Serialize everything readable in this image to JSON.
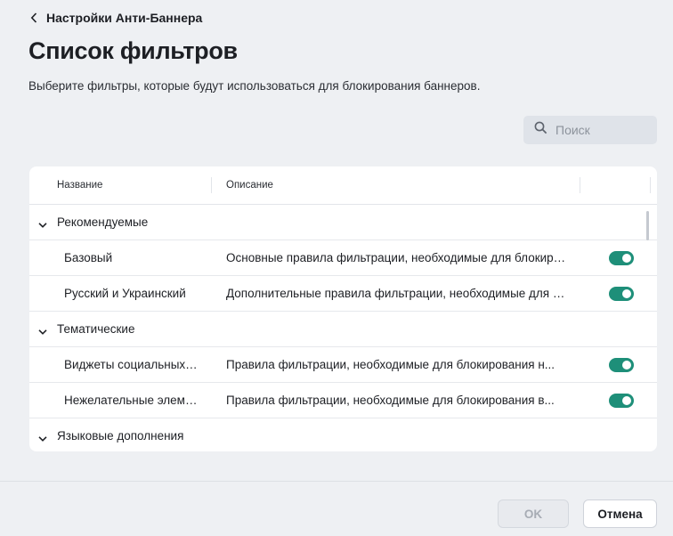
{
  "header": {
    "back_label": "Настройки Анти-Баннера",
    "title": "Список фильтров",
    "description": "Выберите фильтры, которые будут использоваться для блокирования баннеров."
  },
  "search": {
    "placeholder": "Поиск",
    "value": ""
  },
  "table": {
    "columns": {
      "name": "Название",
      "description": "Описание"
    },
    "groups": [
      {
        "name": "Рекомендуемые",
        "expanded": true,
        "items": [
          {
            "name": "Базовый",
            "description": "Основные правила фильтрации, необходимые для блокирования баннеров",
            "enabled": true
          },
          {
            "name": "Русский и Украинский",
            "description": "Дополнительные правила фильтрации, необходимые для блокирования баннеров",
            "enabled": true
          }
        ]
      },
      {
        "name": "Тематические",
        "expanded": true,
        "items": [
          {
            "name": "Виджеты социальных сетей",
            "description": "Правила фильтрации, необходимые для блокирования н...",
            "enabled": true
          },
          {
            "name": "Нежелательные элементы",
            "description": "Правила фильтрации, необходимые для блокирования в...",
            "enabled": true
          }
        ]
      },
      {
        "name": "Языковые дополнения",
        "expanded": true,
        "items": []
      }
    ]
  },
  "footer": {
    "ok_label": "OK",
    "cancel_label": "Отмена"
  },
  "colors": {
    "toggle_on": "#1e8f79",
    "background": "#eef0f3",
    "panel": "#ffffff"
  }
}
